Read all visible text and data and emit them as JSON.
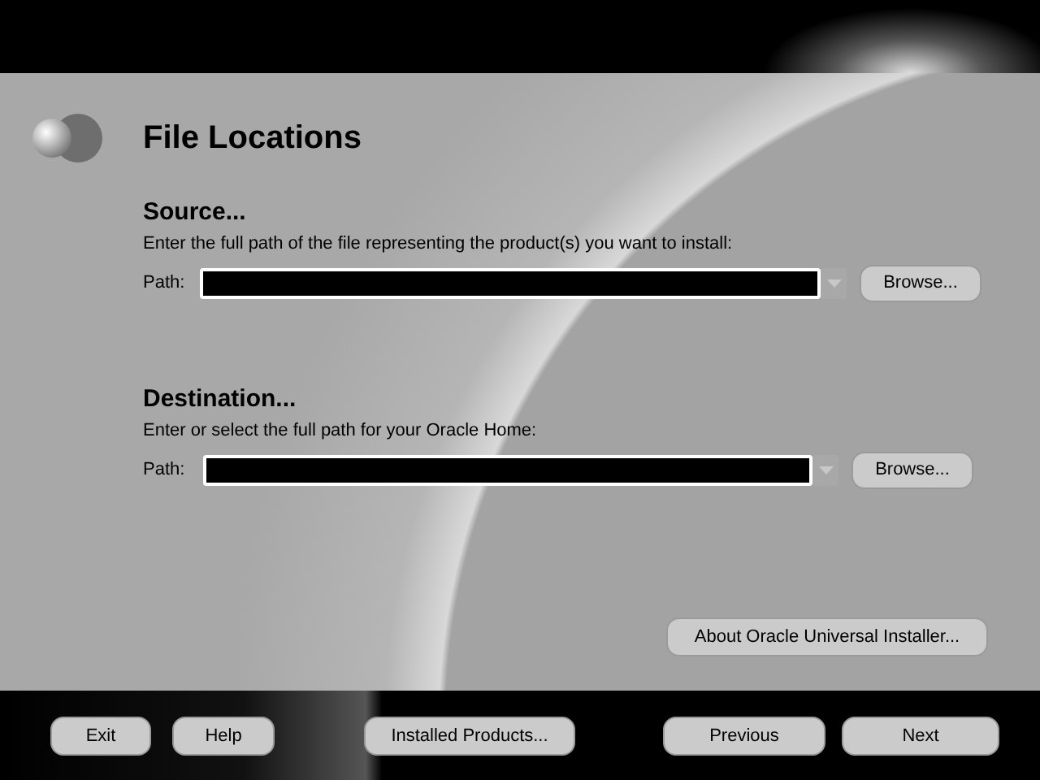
{
  "page": {
    "title": "File Locations"
  },
  "sections": [
    {
      "heading": "Source...",
      "instruction": "Enter the full path of the file representing the product(s) you want to install:",
      "path_label": "Path:",
      "browse_button": "Browse..."
    },
    {
      "heading": "Destination...",
      "instruction": "Enter or select the full path for your Oracle Home:",
      "path_label": "Path:",
      "browse_button": "Browse..."
    }
  ],
  "about_button": "About Oracle Universal Installer...",
  "footer": {
    "left_buttons": [
      "Exit",
      "Help"
    ],
    "center_buttons": [
      "Installed Products..."
    ],
    "right_buttons": [
      "Previous",
      "Next"
    ]
  }
}
